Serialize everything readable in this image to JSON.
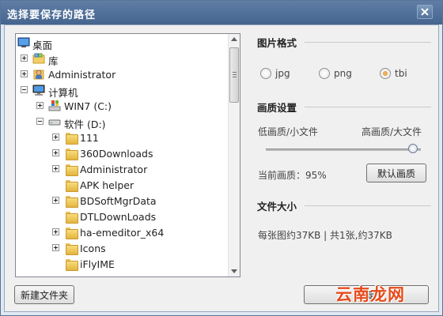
{
  "window": {
    "title": "选择要保存的路径"
  },
  "tree": [
    {
      "label": "桌面",
      "level": 0,
      "toggle": "none",
      "icon": "desktop"
    },
    {
      "label": "库",
      "level": 1,
      "toggle": "plus",
      "icon": "library"
    },
    {
      "label": "Administrator",
      "level": 1,
      "toggle": "plus",
      "icon": "user"
    },
    {
      "label": "计算机",
      "level": 1,
      "toggle": "minus",
      "icon": "computer"
    },
    {
      "label": "WIN7 (C:)",
      "level": 2,
      "toggle": "plus",
      "icon": "windows-drive"
    },
    {
      "label": "软件 (D:)",
      "level": 2,
      "toggle": "minus",
      "icon": "drive"
    },
    {
      "label": "111",
      "level": 3,
      "toggle": "plus",
      "icon": "folder"
    },
    {
      "label": "360Downloads",
      "level": 3,
      "toggle": "plus",
      "icon": "folder"
    },
    {
      "label": "Administrator",
      "level": 3,
      "toggle": "plus",
      "icon": "folder"
    },
    {
      "label": "APK helper",
      "level": 3,
      "toggle": "none",
      "icon": "folder"
    },
    {
      "label": "BDSoftMgrData",
      "level": 3,
      "toggle": "plus",
      "icon": "folder"
    },
    {
      "label": "DTLDownLoads",
      "level": 3,
      "toggle": "none",
      "icon": "folder"
    },
    {
      "label": "ha-emeditor_x64",
      "level": 3,
      "toggle": "plus",
      "icon": "folder"
    },
    {
      "label": "Icons",
      "level": 3,
      "toggle": "plus",
      "icon": "folder"
    },
    {
      "label": "iFlyIME",
      "level": 3,
      "toggle": "none",
      "icon": "folder"
    }
  ],
  "format": {
    "title": "图片格式",
    "options": [
      {
        "label": "jpg",
        "checked": false
      },
      {
        "label": "png",
        "checked": false
      },
      {
        "label": "tbi",
        "checked": true
      }
    ]
  },
  "quality": {
    "title": "画质设置",
    "low_label": "低画质/小文件",
    "high_label": "高画质/大文件",
    "current_label": "当前画质：95%",
    "value_percent": 95,
    "default_button": "默认画质"
  },
  "size": {
    "title": "文件大小",
    "info": "每张图约37KB | 共1张,约37KB"
  },
  "buttons": {
    "new_folder": "新建文件夹",
    "ok": "确定"
  },
  "watermark": "云南龙网",
  "colors": {
    "titlebar": "#45658f",
    "radio_checked": "#d98b1f",
    "watermark": "#e64a19"
  }
}
